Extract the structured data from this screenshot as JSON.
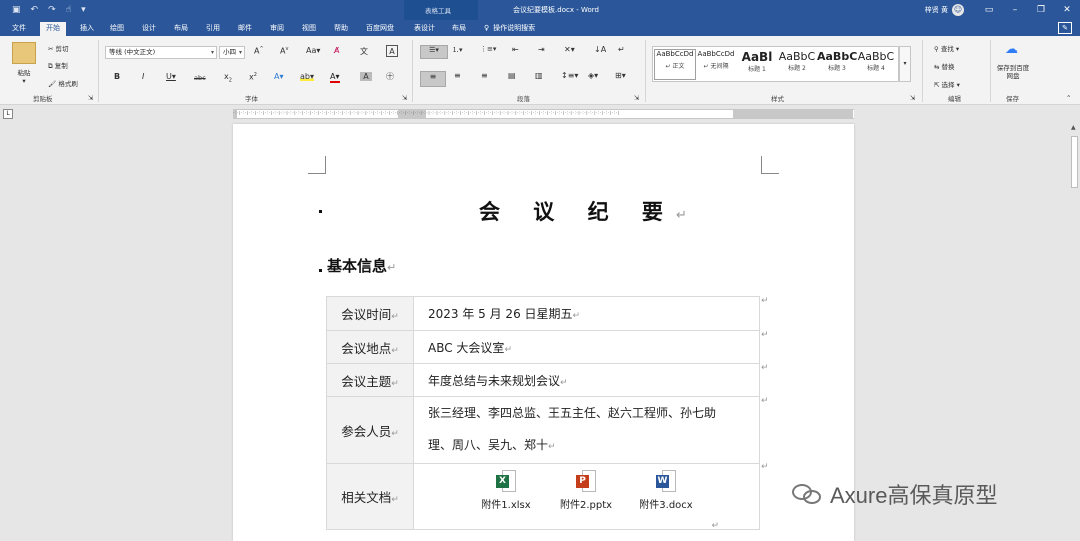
{
  "window": {
    "title": "会议纪要模板.docx - Word",
    "context_tab_group": "表格工具",
    "user": "梓贤 黄",
    "user_initial": "☺"
  },
  "tabs": [
    "文件",
    "开始",
    "插入",
    "绘图",
    "设计",
    "布局",
    "引用",
    "邮件",
    "审阅",
    "视图",
    "帮助",
    "百度网盘",
    "表设计",
    "布局"
  ],
  "active_tab": "开始",
  "tell_me": "操作说明搜索",
  "ribbon": {
    "clipboard": {
      "paste": "粘贴",
      "cut": "剪切",
      "copy": "复制",
      "format_painter": "格式刷",
      "label": "剪贴板"
    },
    "font": {
      "name": "等线 (中文正文)",
      "size": "小四",
      "label": "字体"
    },
    "paragraph": {
      "label": "段落"
    },
    "styles": {
      "label": "样式",
      "items": [
        {
          "preview": "AaBbCcDd",
          "name": "↵ 正文"
        },
        {
          "preview": "AaBbCcDd",
          "name": "↵ 无间隔"
        },
        {
          "preview": "AaBl",
          "name": "标题 1"
        },
        {
          "preview": "AaBbC",
          "name": "标题 2"
        },
        {
          "preview": "AaBbC",
          "name": "标题 3"
        },
        {
          "preview": "AaBbC",
          "name": "标题 4"
        }
      ]
    },
    "editing": {
      "find": "查找",
      "replace": "替换",
      "select": "选择",
      "label": "编辑"
    },
    "save": {
      "button": "保存到百度网盘",
      "label": "保存"
    }
  },
  "document": {
    "title": "会 议 纪 要",
    "heading": "基本信息",
    "para_mark": "↵",
    "table": [
      {
        "label": "会议时间",
        "value": "2023 年 5 月 26 日星期五"
      },
      {
        "label": "会议地点",
        "value": "ABC 大会议室"
      },
      {
        "label": "会议主题",
        "value": "年度总结与未来规划会议"
      },
      {
        "label": "参会人员",
        "value_line1": "张三经理、李四总监、王五主任、赵六工程师、孙七助",
        "value_line2": "理、周八、吴九、郑十"
      },
      {
        "label": "相关文档"
      }
    ],
    "attachments": [
      {
        "name": "附件1.xlsx",
        "letter": "X",
        "color": "#1f7244"
      },
      {
        "name": "附件2.pptx",
        "letter": "P",
        "color": "#c43e1c"
      },
      {
        "name": "附件3.docx",
        "letter": "W",
        "color": "#2b579a"
      }
    ]
  },
  "watermark": "Axure高保真原型"
}
